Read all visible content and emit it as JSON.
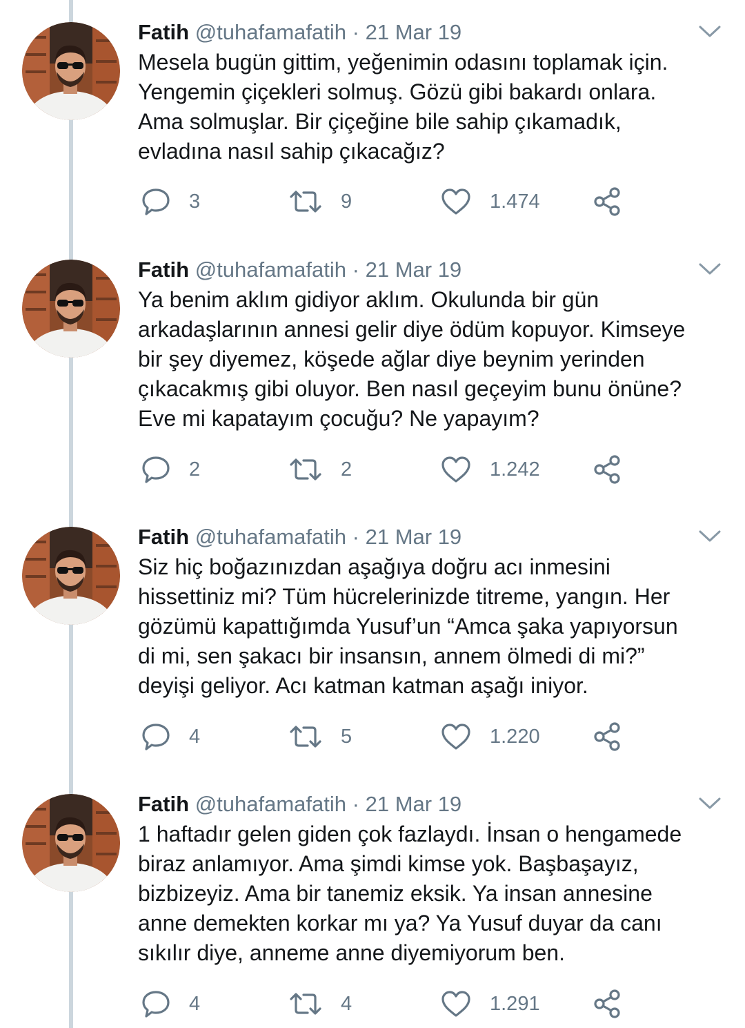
{
  "colors": {
    "name": "#14171a",
    "secondary": "#657786",
    "thread_line": "#ccd6dd"
  },
  "icons": {
    "reply": "reply-icon",
    "retweet": "retweet-icon",
    "like": "heart-icon",
    "share": "share-icon",
    "caret": "chevron-down-icon"
  },
  "tweets": [
    {
      "name": "Fatih",
      "handle": "@tuhafamafatih",
      "separator": "·",
      "date": "21 Mar 19",
      "text": "Mesela bugün gittim, yeğenimin odasını toplamak için.\nYengemin çiçekleri solmuş. Gözü gibi bakardı onlara.\nAma solmuşlar. Bir çiçeğine bile sahip çıkamadık,\nevladına nasıl sahip çıkacağız?",
      "replies": "3",
      "retweets": "9",
      "likes": "1.474"
    },
    {
      "name": "Fatih",
      "handle": "@tuhafamafatih",
      "separator": "·",
      "date": "21 Mar 19",
      "text": "Ya benim aklım gidiyor aklım. Okulunda bir gün\narkadaşlarının annesi gelir diye ödüm kopuyor. Kimseye\nbir şey diyemez, köşede ağlar diye beynim yerinden\nçıkacakmış gibi oluyor. Ben nasıl geçeyim bunu önüne?\nEve mi kapatayım çocuğu? Ne yapayım?",
      "replies": "2",
      "retweets": "2",
      "likes": "1.242"
    },
    {
      "name": "Fatih",
      "handle": "@tuhafamafatih",
      "separator": "·",
      "date": "21 Mar 19",
      "text": "Siz hiç boğazınızdan aşağıya doğru acı inmesini\nhissettiniz mi? Tüm hücrelerinizde titreme, yangın. Her\ngözümü kapattığımda Yusuf’un “Amca şaka yapıyorsun\ndi mi, sen şakacı bir insansın, annem ölmedi di mi?”\ndeyişi geliyor. Acı katman katman aşağı iniyor.",
      "replies": "4",
      "retweets": "5",
      "likes": "1.220"
    },
    {
      "name": "Fatih",
      "handle": "@tuhafamafatih",
      "separator": "·",
      "date": "21 Mar 19",
      "text": "1 haftadır gelen giden çok fazlaydı. İnsan o hengamede\nbiraz anlamıyor. Ama şimdi kimse yok. Başbaşayız,\nbizbizeyiz. Ama bir tanemiz eksik. Ya insan annesine\nanne demekten korkar mı ya? Ya Yusuf duyar da canı\nsıkılır diye, anneme anne diyemiyorum ben.",
      "replies": "4",
      "retweets": "4",
      "likes": "1.291"
    }
  ]
}
